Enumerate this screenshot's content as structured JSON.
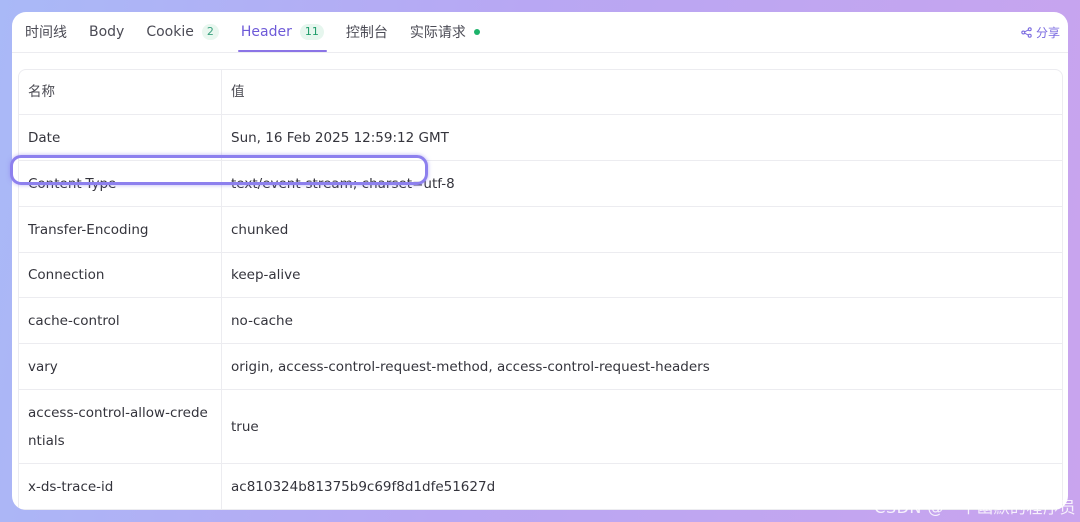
{
  "tabs": [
    {
      "label": "时间线"
    },
    {
      "label": "Body"
    },
    {
      "label": "Cookie",
      "badge": "2"
    },
    {
      "label": "Header",
      "badge": "11"
    },
    {
      "label": "控制台"
    },
    {
      "label": "实际请求"
    }
  ],
  "active_tab": "Header",
  "share_label": "分享",
  "table": {
    "headers": [
      "名称",
      "值"
    ],
    "rows": [
      {
        "name": "Date",
        "value": "Sun, 16 Feb 2025 12:59:12 GMT"
      },
      {
        "name": "Content-Type",
        "value": "text/event-stream; charset=utf-8"
      },
      {
        "name": "Transfer-Encoding",
        "value": "chunked"
      },
      {
        "name": "Connection",
        "value": "keep-alive"
      },
      {
        "name": "cache-control",
        "value": "no-cache"
      },
      {
        "name": "vary",
        "value": "origin, access-control-request-method, access-control-request-headers"
      },
      {
        "name": "access-control-allow-credentials",
        "value": "true"
      },
      {
        "name": "x-ds-trace-id",
        "value": "ac810324b81375b9c69f8d1dfe51627d"
      }
    ]
  },
  "highlighted_row": "Content-Type",
  "watermark": "CSDN @一个幽默的程序员",
  "colors": {
    "accent": "#6e5ad8",
    "status_dot": "#1db36b",
    "highlight_border": "#8d80ee"
  }
}
